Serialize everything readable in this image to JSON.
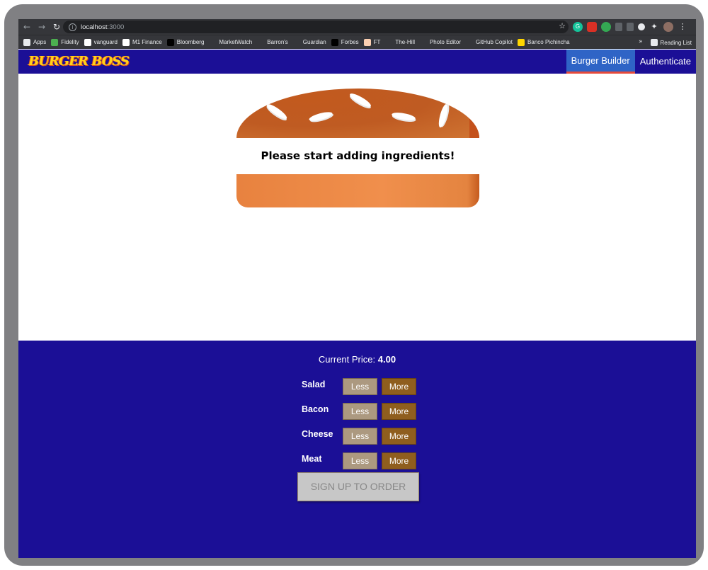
{
  "browser": {
    "url_host": "localhost",
    "url_port": ":3000",
    "bookmarks": [
      {
        "label": "Apps",
        "icon": "apps-grid-icon",
        "color": "#e8eaed"
      },
      {
        "label": "Fidelity",
        "icon": "fidelity-icon",
        "color": "#4caf50"
      },
      {
        "label": "vanguard",
        "icon": "vanguard-icon",
        "color": "#ffffff"
      },
      {
        "label": "M1 Finance",
        "icon": "m1-icon",
        "color": "#ffffff"
      },
      {
        "label": "Bloomberg",
        "icon": "bloomberg-icon",
        "color": "#000000"
      },
      {
        "label": "MarketWatch",
        "icon": "marketwatch-icon",
        "color": "#35363a"
      },
      {
        "label": "Barron's",
        "icon": "barrons-icon",
        "color": "#35363a"
      },
      {
        "label": "Guardian",
        "icon": "guardian-icon",
        "color": "#35363a"
      },
      {
        "label": "Forbes",
        "icon": "forbes-icon",
        "color": "#000000"
      },
      {
        "label": "FT",
        "icon": "ft-icon",
        "color": "#fcd0b1"
      },
      {
        "label": "The-Hill",
        "icon": "the-hill-icon",
        "color": "#35363a"
      },
      {
        "label": "Photo Editor",
        "icon": "photo-editor-icon",
        "color": "#35363a"
      },
      {
        "label": "GitHub Copilot",
        "icon": "github-icon",
        "color": "#35363a"
      },
      {
        "label": "Banco Pichincha",
        "icon": "banco-icon",
        "color": "#ffd600"
      }
    ],
    "reading_list": "Reading List",
    "more_bookmarks": "»"
  },
  "header": {
    "logo": "BURGER BOSS",
    "nav": [
      {
        "label": "Burger Builder",
        "active": true
      },
      {
        "label": "Authenticate",
        "active": false
      }
    ]
  },
  "burger": {
    "message": "Please start adding ingredients!"
  },
  "build_controls": {
    "price_label": "Current Price:",
    "price_value": "4.00",
    "less_label": "Less",
    "more_label": "More",
    "ingredients": [
      {
        "label": "Salad"
      },
      {
        "label": "Bacon"
      },
      {
        "label": "Cheese"
      },
      {
        "label": "Meat"
      }
    ],
    "order_button": "SIGN UP TO ORDER"
  },
  "colors": {
    "toolbar_bg": "#1b0f96",
    "active_nav_bg": "#2f64c6",
    "less_button": "#ac9980",
    "more_button": "#8f5e1e",
    "bun": "#e8823f"
  }
}
